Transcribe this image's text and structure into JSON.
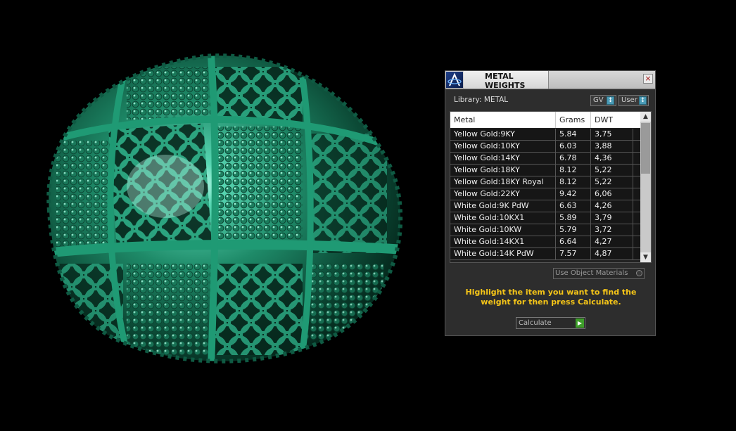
{
  "panel": {
    "title": "METAL WEIGHTS",
    "close_symbol": "×",
    "library_label": "Library: METAL",
    "toggles": [
      {
        "label": "GV"
      },
      {
        "label": "User"
      }
    ],
    "toggle_knob": "↕",
    "table": {
      "headers": [
        "Metal",
        "Grams",
        "DWT"
      ],
      "rows": [
        {
          "metal": "Yellow Gold:9KY",
          "grams": "5.84",
          "dwt": "3,75"
        },
        {
          "metal": "Yellow Gold:10KY",
          "grams": "6.03",
          "dwt": "3,88"
        },
        {
          "metal": "Yellow Gold:14KY",
          "grams": "6.78",
          "dwt": "4,36"
        },
        {
          "metal": "Yellow Gold:18KY",
          "grams": "8.12",
          "dwt": "5,22"
        },
        {
          "metal": "Yellow Gold:18KY Royal",
          "grams": "8.12",
          "dwt": "5,22"
        },
        {
          "metal": "Yellow Gold:22KY",
          "grams": "9.42",
          "dwt": "6,06"
        },
        {
          "metal": "White Gold:9K PdW",
          "grams": "6.63",
          "dwt": "4,26"
        },
        {
          "metal": "White Gold:10KX1",
          "grams": "5.89",
          "dwt": "3,79"
        },
        {
          "metal": "White Gold:10KW",
          "grams": "5.79",
          "dwt": "3,72"
        },
        {
          "metal": "White Gold:14KX1",
          "grams": "6.64",
          "dwt": "4,27"
        },
        {
          "metal": "White Gold:14K PdW",
          "grams": "7.57",
          "dwt": "4,87"
        }
      ],
      "scroll_up": "▲",
      "scroll_down": "▼"
    },
    "use_object_materials_label": "Use Object Materials",
    "instructions": "Highlight the item you want to find the weight for then press Calculate.",
    "calculate_label": "Calculate",
    "calculate_arrow": "▶"
  },
  "colors": {
    "model_green": "#1e8a68",
    "instructions_yellow": "#f5c518"
  }
}
